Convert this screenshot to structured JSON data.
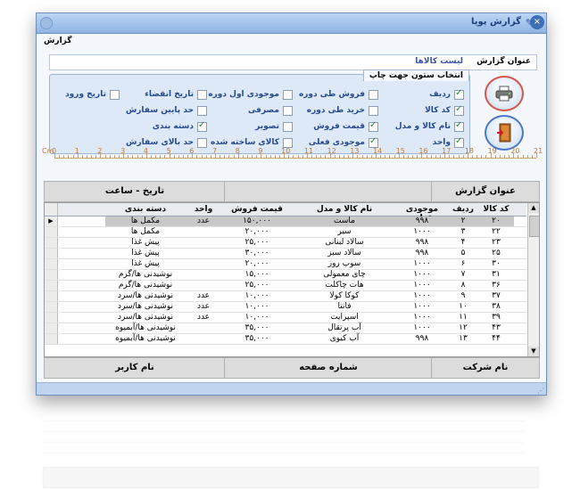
{
  "window": {
    "title": "گزارش پویا",
    "close_glyph": "×"
  },
  "section_label": "گزارش",
  "report_title": {
    "label": "عنوان گزارش",
    "value": "لیست کالاها"
  },
  "column_panel": {
    "header": "انتخاب ستون جهت چاپ",
    "items": [
      {
        "label": "ردیف",
        "checked": true
      },
      {
        "label": "کد کالا",
        "checked": true
      },
      {
        "label": "نام کالا و مدل",
        "checked": true
      },
      {
        "label": "واحد",
        "checked": true
      },
      {
        "label": "فروش طی دوره",
        "checked": false
      },
      {
        "label": "خرید طی دوره",
        "checked": false
      },
      {
        "label": "قیمت فروش",
        "checked": true
      },
      {
        "label": "موجودی فعلی",
        "checked": true
      },
      {
        "label": "موجودی اول دوره",
        "checked": false
      },
      {
        "label": "مصرفی",
        "checked": false
      },
      {
        "label": "تصویر",
        "checked": false
      },
      {
        "label": "کالای ساخته شده",
        "checked": false
      },
      {
        "label": "تاریخ انقضاء",
        "checked": false
      },
      {
        "label": "حد پایین سفارش",
        "checked": false
      },
      {
        "label": "دسته بندی",
        "checked": true
      },
      {
        "label": "حد بالای سفارش",
        "checked": false
      },
      {
        "label": "تاریخ ورود",
        "checked": false
      }
    ]
  },
  "ruler": {
    "unit": "Cm",
    "numbers": [
      "0",
      "1",
      "2",
      "3",
      "4",
      "5",
      "6",
      "7",
      "8",
      "9",
      "10",
      "11",
      "12",
      "13",
      "14",
      "15",
      "16",
      "17",
      "18",
      "19",
      "20",
      "21"
    ]
  },
  "header_band": {
    "report_title": "عنوان گزارش",
    "date_time": "تاریخ - ساعت"
  },
  "footer_band": {
    "company": "نام شرکت",
    "page_number": "شماره صفحه",
    "user": "نام کاربر"
  },
  "grid": {
    "columns": [
      "کد کالا",
      "ردیف",
      "موجودی فعلی",
      "نام کالا و مدل",
      "قیمت فروش",
      "واحد",
      "دسته بندی"
    ],
    "rows": [
      [
        "۲۰",
        "۲",
        "۹۹۸",
        "ماست",
        "۱۵۰,۰۰۰",
        "عدد",
        "مکمل ها"
      ],
      [
        "۲۲",
        "۳",
        "۱۰۰۰",
        "سیر",
        "۲۰,۰۰۰",
        "",
        "مکمل ها"
      ],
      [
        "۲۳",
        "۴",
        "۹۹۸",
        "سالاد لبنانی",
        "۲۵,۰۰۰",
        "",
        "پیش غذا"
      ],
      [
        "۲۵",
        "۵",
        "۹۹۸",
        "سالاد سبز",
        "۳۰,۰۰۰",
        "",
        "پیش غذا"
      ],
      [
        "۳۰",
        "۶",
        "۱۰۰۰",
        "سوپ روز",
        "۲۰,۰۰۰",
        "",
        "پیش غذا"
      ],
      [
        "۳۱",
        "۷",
        "۱۰۰۰",
        "چای معمولی",
        "۱۵,۰۰۰",
        "",
        "نوشیدنی ها/گرم"
      ],
      [
        "۳۶",
        "۸",
        "۱۰۰۰",
        "هات چاکلت",
        "۲۵,۰۰۰",
        "",
        "نوشیدنی ها/گرم"
      ],
      [
        "۳۷",
        "۹",
        "۱۰۰۰",
        "کوکا کولا",
        "۱۰,۰۰۰",
        "عدد",
        "نوشیدنی ها/سرد"
      ],
      [
        "۳۸",
        "۱۰",
        "۱۰۰۰",
        "فانتا",
        "۱۰,۰۰۰",
        "عدد",
        "نوشیدنی ها/سرد"
      ],
      [
        "۳۹",
        "۱۱",
        "۱۰۰۰",
        "اسپرایت",
        "۱۰,۰۰۰",
        "عدد",
        "نوشیدنی ها/سرد"
      ],
      [
        "۴۳",
        "۱۲",
        "۱۰۰۰",
        "آب پرتقال",
        "۳۵,۰۰۰",
        "",
        "نوشیدنی ها/آبمیوه"
      ],
      [
        "۴۴",
        "۱۳",
        "۹۹۸",
        "آب کیوی",
        "۳۵,۰۰۰",
        "",
        "نوشیدنی ها/آبمیوه"
      ]
    ]
  }
}
